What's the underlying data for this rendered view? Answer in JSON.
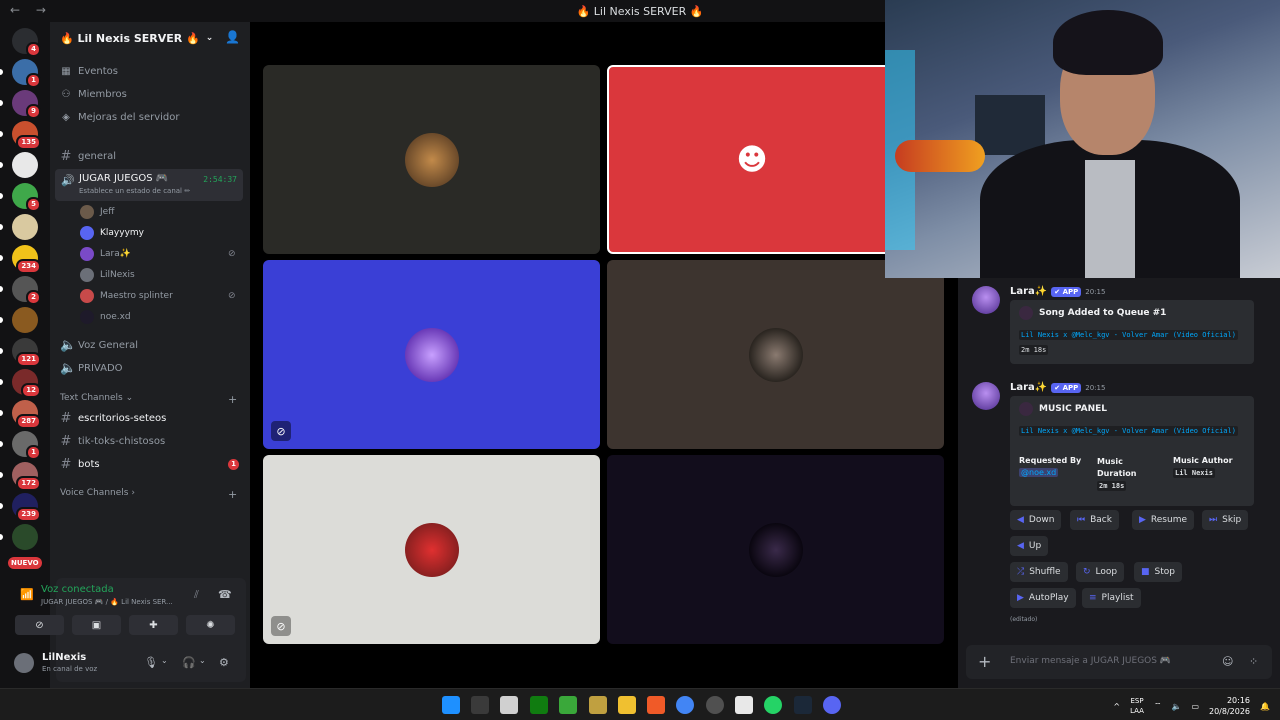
{
  "titlebar": {
    "title": "🔥 Lil Nexis SERVER 🔥",
    "nav": "← →"
  },
  "rail": {
    "servers": [
      {
        "name": "discord-home-icon",
        "badge": "4",
        "color": "#2b2d31"
      },
      {
        "name": "server-1",
        "badge": "1",
        "color": "#3b6ea8"
      },
      {
        "name": "server-2",
        "badge": "9",
        "color": "#6a3a7a"
      },
      {
        "name": "server-3",
        "badge": "135",
        "color": "#c9502e"
      },
      {
        "name": "server-4",
        "badge": "",
        "color": "#e8e8e8"
      },
      {
        "name": "server-5",
        "badge": "5",
        "color": "#3fa84a"
      },
      {
        "name": "server-6",
        "badge": "",
        "color": "#d9c9a0"
      },
      {
        "name": "server-7",
        "badge": "234",
        "color": "#f0c21a"
      },
      {
        "name": "server-8",
        "badge": "2",
        "color": "#555"
      },
      {
        "name": "server-9",
        "badge": "",
        "color": "#8a5a20"
      },
      {
        "name": "server-10",
        "badge": "121",
        "color": "#3a3a3a"
      },
      {
        "name": "server-11",
        "badge": "12",
        "color": "#7a2a2a"
      },
      {
        "name": "server-12",
        "badge": "287",
        "color": "#c0604a"
      },
      {
        "name": "server-13",
        "badge": "1",
        "color": "#6a6a6a"
      },
      {
        "name": "server-14",
        "badge": "172",
        "color": "#a06060"
      },
      {
        "name": "server-15",
        "badge": "239",
        "color": "#202060"
      },
      {
        "name": "server-16",
        "badge": "",
        "color": "#2a4a2a"
      }
    ],
    "new_label": "NUEVO"
  },
  "sidebar": {
    "server_name": "🔥 Lil Nexis SERVER 🔥",
    "menu": [
      "Eventos",
      "Miembros",
      "Mejoras del servidor"
    ],
    "channel_general": "general",
    "voice_channel": {
      "name": "JUGAR JUEGOS 🎮",
      "status": "Establece un estado de canal ✏",
      "timer": "2:54:37"
    },
    "voice_users": [
      {
        "name": "Jeff",
        "color": "#6b5a4a"
      },
      {
        "name": "Klayyymy",
        "color": "#5865f2"
      },
      {
        "name": "Lara✨",
        "color": "#7a4ac8"
      },
      {
        "name": "LilNexis",
        "color": "#6b6f78"
      },
      {
        "name": "Maestro splinter",
        "color": "#c84a4a"
      },
      {
        "name": "noe.xd",
        "color": "#1e1a2a"
      }
    ],
    "other_voice": [
      "Voz General",
      "PRIVADO"
    ],
    "text_category": "Text Channels",
    "text_channels": [
      "escritorios-seteos",
      "tik-toks-chistosos",
      "bots"
    ],
    "bots_unread": "1",
    "voice_category": "Voice Channels"
  },
  "voice_panel": {
    "title": "Voz conectada",
    "subtitle": "JUGAR JUEGOS 🎮 / 🔥 Lil Nexis SER..."
  },
  "user": {
    "name": "LilNexis",
    "status": "En canal de voz"
  },
  "chat": {
    "msg1": {
      "author": "Lara✨",
      "app": "✔ APP",
      "time": "20:15",
      "title": "Song Added to Queue #1",
      "song": "Lil Nexis x @Melc_kgv - Volver Amar (Video Oficial)",
      "duration": "2m 18s"
    },
    "msg2": {
      "author": "Lara✨",
      "app": "✔ APP",
      "time": "20:15",
      "title": "MUSIC PANEL",
      "song": "Lil Nexis x @Melc_kgv - Volver Amar (Video Oficial)",
      "requested_label": "Requested By",
      "requested_value": "@noe.xd",
      "duration_label": "Music Duration",
      "duration_value": "2m 18s",
      "author_label": "Music Author",
      "author_value": "Lil Nexis"
    },
    "buttons": [
      "Down",
      "Back",
      "Resume",
      "Skip",
      "Up",
      "Shuffle",
      "Loop",
      "Stop",
      "AutoPlay",
      "Playlist"
    ],
    "edited": "(editado)",
    "input_placeholder": "Enviar mensaje a JUGAR JUEGOS 🎮"
  },
  "tray": {
    "lang1": "ESP",
    "lang2": "LAA",
    "time": "20:16",
    "date": "20/8/2026",
    "caret": "^"
  }
}
